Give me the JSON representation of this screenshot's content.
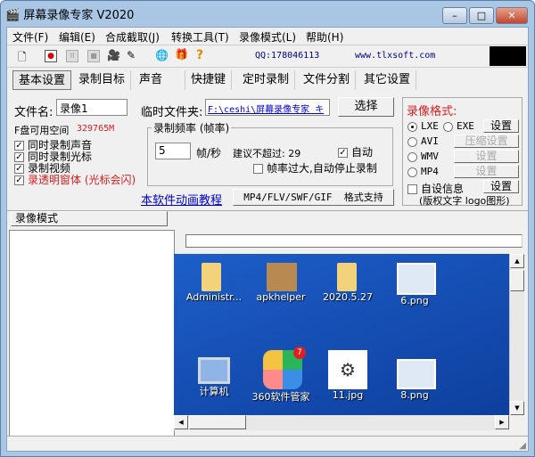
{
  "window": {
    "title": "屏幕录像专家 V2020",
    "minimize": "–",
    "maximize": "□",
    "close": "✕"
  },
  "menu": [
    "文件(F)",
    "编辑(E)",
    "合成截取(J)",
    "转换工具(T)",
    "录像模式(L)",
    "帮助(H)"
  ],
  "toolbar": {
    "qq": "QQ:178046113",
    "website": "www.tlxsoft.com",
    "icons": [
      "new-icon",
      "record-icon",
      "pause-icon",
      "stop-icon",
      "camera-icon",
      "pen-icon",
      "globe-icon",
      "gift-icon",
      "help-icon"
    ]
  },
  "tabs": [
    "基本设置",
    "录制目标",
    "声音",
    "快捷键",
    "定时录制",
    "文件分割",
    "其它设置"
  ],
  "basic": {
    "filename_label": "文件名:",
    "filename_value": "录像1",
    "tempdir_label": "临时文件夹:",
    "tempdir_value": "F:\\ceshi\\屏幕录像专家 キ",
    "choose_button": "选择",
    "disk_label": "F盘可用空间",
    "disk_value": "329765M",
    "checks": [
      {
        "label": "同时录制声音",
        "checked": true
      },
      {
        "label": "同时录制光标",
        "checked": true
      },
      {
        "label": "录制视频",
        "checked": true
      },
      {
        "label": "录透明窗体 (光标会闪)",
        "checked": true
      }
    ],
    "fps_group": "录制频率 (帧率)",
    "fps_value": "5",
    "fps_unit": "帧/秒",
    "fps_suggest": "建议不超过: 29",
    "auto_label": "自动",
    "auto_checked": true,
    "stop_label": "帧率过大,自动停止录制",
    "stop_checked": false,
    "tutorial_link": "本软件动画教程",
    "format_support_button": "MP4/FLV/SWF/GIF  格式支持"
  },
  "format": {
    "title": "录像格式:",
    "lxe": "LXE",
    "exe": "EXE",
    "avi": "AVI",
    "wmv": "WMV",
    "mp4": "MP4",
    "selected": "LXE",
    "settings": "设置",
    "compress_settings": "压缩设置",
    "custom_info": "自设信息",
    "custom_checked": false,
    "custom_note": "(版权文字 logo图形)"
  },
  "mode_tab": "录像模式",
  "desktop": {
    "icons": [
      "Administr...",
      "apkhelper",
      "2020.5.27",
      "6.png",
      "计算机",
      "360软件管家",
      "11.jpg",
      "8.png"
    ],
    "badge": "7"
  },
  "colors": {
    "desktop": "#1a4fb0",
    "red": "#d42020",
    "link": "#0000cc"
  }
}
